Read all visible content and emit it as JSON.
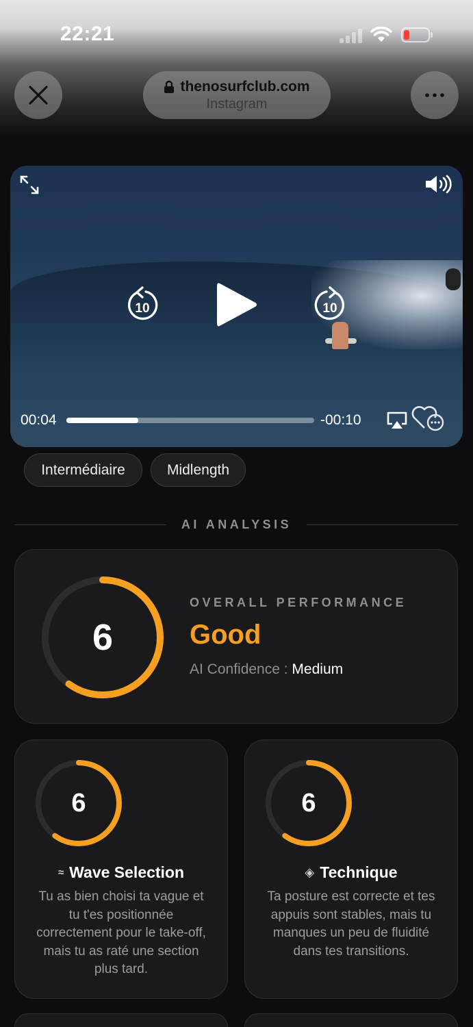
{
  "status_bar": {
    "time": "22:21"
  },
  "browser": {
    "domain": "thenosurfclub.com",
    "source": "Instagram"
  },
  "video": {
    "current_time": "00:04",
    "remaining_time": "-00:10",
    "progress_fraction": 0.29,
    "skip_back_seconds": "10",
    "skip_forward_seconds": "10"
  },
  "tags": [
    "Intermédiaire",
    "Midlength"
  ],
  "section_divider": "AI ANALYSIS",
  "overall": {
    "label": "OVERALL PERFORMANCE",
    "score": "6",
    "score_fraction": 0.6,
    "rating": "Good",
    "confidence_label": "AI Confidence : ",
    "confidence_value": "Medium"
  },
  "metrics": [
    {
      "icon": "≈",
      "title": "Wave Selection",
      "score": "6",
      "score_fraction": 0.6,
      "description": "Tu as bien choisi ta vague et tu t'es positionnée correctement pour le take-off, mais tu as raté une section plus tard."
    },
    {
      "icon": "◈",
      "title": "Technique",
      "score": "6",
      "score_fraction": 0.6,
      "description": "Ta posture est correcte et tes appuis sont stables, mais tu manques un peu de fluidité dans tes transitions."
    }
  ],
  "colors": {
    "accent": "#f5a021",
    "background": "#0d0d0f",
    "card": "#1a1a1c",
    "ring_track": "#2c2c2e"
  }
}
